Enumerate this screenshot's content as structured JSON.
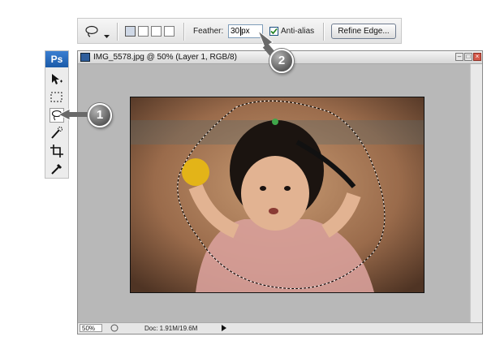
{
  "options_bar": {
    "lasso_tool_icon": "lasso-icon",
    "feather_label": "Feather:",
    "feather_value": "30",
    "feather_unit": "px",
    "anti_alias_label": "Anti-alias",
    "anti_alias_checked": true,
    "refine_edge_label": "Refine Edge..."
  },
  "toolbox": {
    "logo": "Ps",
    "tools": [
      "move-tool-icon",
      "marquee-tool-icon",
      "lasso-tool-icon",
      "quick-selection-tool-icon",
      "crop-tool-icon",
      "eyedropper-tool-icon"
    ]
  },
  "document": {
    "title": "IMG_5578.jpg @ 50% (Layer 1, RGB/8)",
    "status_zoom": "50%",
    "status_doc": "Doc: 1.91M/19.6M"
  },
  "callouts": {
    "one": "1",
    "two": "2"
  },
  "colors": {
    "callout_fill": "#5c5c5c",
    "photo_tint": "#9a6b4b",
    "accent": "#1a5aa8"
  }
}
